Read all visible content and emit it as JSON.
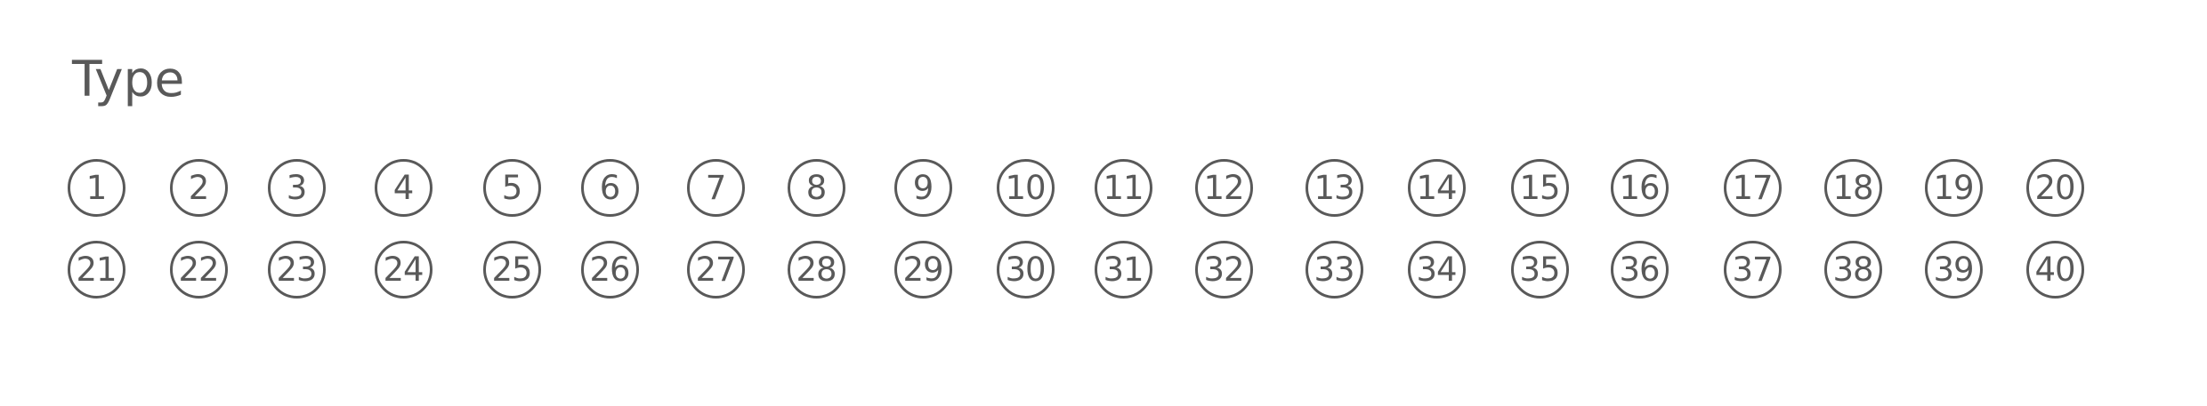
{
  "question": {
    "label": "Type"
  },
  "choices": [
    "1",
    "2",
    "3",
    "4",
    "5",
    "6",
    "7",
    "8",
    "9",
    "10",
    "11",
    "12",
    "13",
    "14",
    "15",
    "16",
    "17",
    "18",
    "19",
    "20",
    "21",
    "22",
    "23",
    "24",
    "25",
    "26",
    "27",
    "28",
    "29",
    "30",
    "31",
    "32",
    "33",
    "34",
    "35",
    "36",
    "37",
    "38",
    "39",
    "40"
  ],
  "colors": {
    "ink": "#595959",
    "background": "#ffffff"
  }
}
